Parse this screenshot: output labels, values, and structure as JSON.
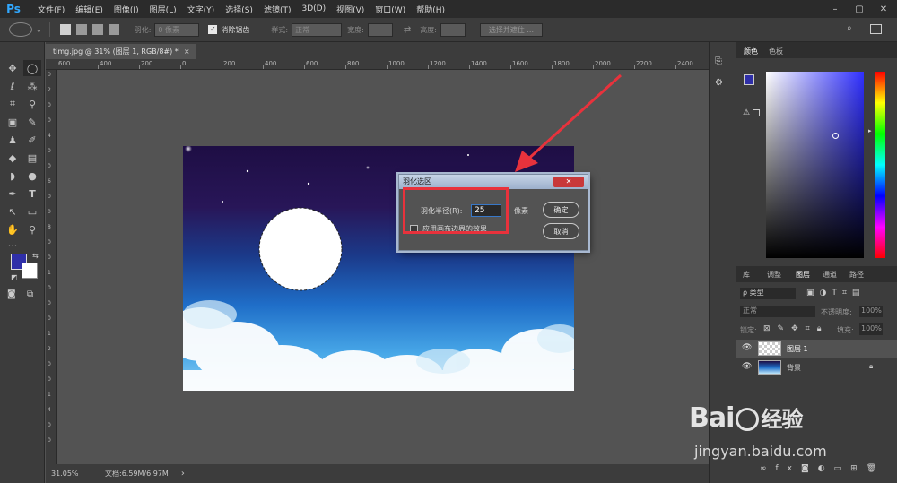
{
  "app": {
    "logo": "Ps",
    "menus": [
      "文件(F)",
      "编辑(E)",
      "图像(I)",
      "图层(L)",
      "文字(Y)",
      "选择(S)",
      "滤镜(T)",
      "3D(D)",
      "视图(V)",
      "窗口(W)",
      "帮助(H)"
    ]
  },
  "options": {
    "feather_label": "羽化:",
    "feather_value": "0 像素",
    "antialias_label": "消除锯齿",
    "style_label": "样式:",
    "style_value": "正常",
    "width_label": "宽度:",
    "height_label": "高度:",
    "select_mask_button": "选择并遮住 ..."
  },
  "document": {
    "tab_title": "timg.jpg @ 31% (图层 1, RGB/8#) *",
    "ruler_top": [
      "600",
      "400",
      "200",
      "0",
      "200",
      "400",
      "600",
      "800",
      "1000",
      "1200",
      "1400",
      "1600",
      "1800",
      "2000",
      "2200",
      "2400"
    ],
    "ruler_left": [
      "0",
      "2",
      "0",
      "0",
      "4",
      "0",
      "0",
      "6",
      "0",
      "0",
      "8",
      "0",
      "0",
      "1",
      "0",
      "0",
      "0",
      "1",
      "2",
      "0",
      "0",
      "1",
      "4",
      "0",
      "0"
    ]
  },
  "status": {
    "zoom": "31.05%",
    "doc_info": "文档:6.59M/6.97M",
    "arrow": "›"
  },
  "dialog": {
    "title": "羽化选区",
    "radius_label": "羽化半径(R):",
    "radius_value": "25",
    "unit": "像素",
    "ok_button": "确定",
    "cancel_button": "取消",
    "checkbox_label": "应用画布边界的效果"
  },
  "panels": {
    "color_tabs": [
      "颜色",
      "色板"
    ],
    "layer_tabs": [
      "库",
      "调整",
      "图层",
      "通道",
      "路径"
    ],
    "kind_filter": "ρ 类型",
    "blend_mode": "正常",
    "opacity_label": "不透明度:",
    "opacity_value": "100%",
    "lock_label": "锁定:",
    "fill_label": "填充:",
    "fill_value": "100%",
    "layers": [
      {
        "name": "图层 1"
      },
      {
        "name": "背景"
      }
    ],
    "footer_icons": [
      "∞",
      "fx"
    ]
  },
  "watermark": {
    "brand_a": "Bai",
    "brand_b": "经验",
    "url": "jingyan.baidu.com"
  },
  "colors": {
    "foreground": "#2f2fa8",
    "background": "#ffffff",
    "accent_red": "#e8323c"
  }
}
